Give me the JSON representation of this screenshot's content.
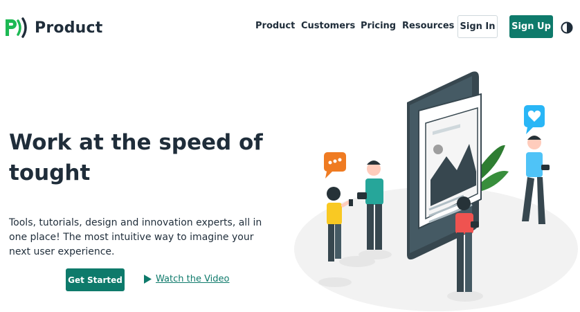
{
  "brand": {
    "name": "Product"
  },
  "nav": {
    "items": [
      {
        "label": "Product"
      },
      {
        "label": "Customers"
      },
      {
        "label": "Pricing"
      },
      {
        "label": "Resources"
      }
    ],
    "signin_label": "Sign In",
    "signup_label": "Sign Up",
    "theme_toggle_icon": "contrast-icon"
  },
  "hero": {
    "title": "Work at the speed of tought",
    "subtitle": "Tools, tutorials, design and innovation experts, all in one place! The most intuitive way to imagine your next user experience.",
    "cta_primary": "Get Started",
    "cta_secondary": "Watch the Video"
  },
  "colors": {
    "brand_green": "#0e7a6b",
    "logo_green": "#1db954",
    "text_dark": "#1f2d3a"
  }
}
